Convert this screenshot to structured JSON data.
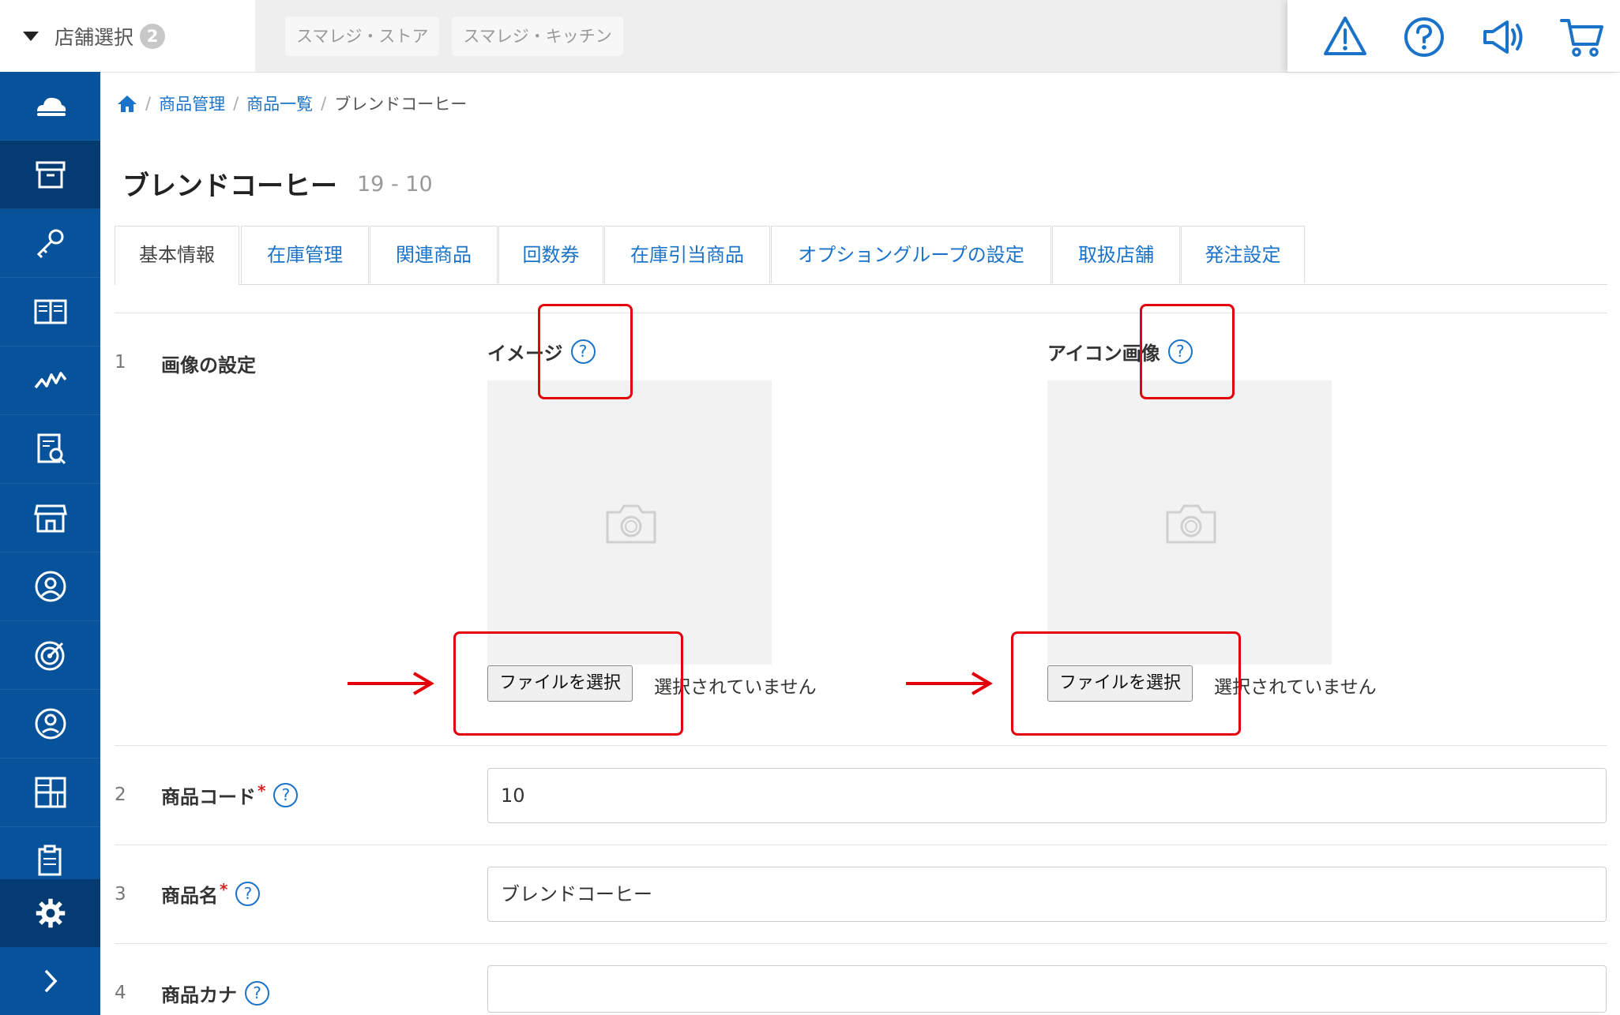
{
  "topbar": {
    "store_select_label": "店舗選択",
    "store_count": "2",
    "store_chips": [
      "スマレジ・ストア",
      "スマレジ・キッチン"
    ],
    "icons": [
      "alert-triangle-icon",
      "help-circle-icon",
      "megaphone-icon",
      "cart-icon"
    ]
  },
  "sidebar": {
    "items": [
      "cloud-icon",
      "archive-box-icon",
      "key-icon",
      "book-icon",
      "chart-line-icon",
      "report-search-icon",
      "store-icon",
      "user-circle-icon",
      "target-icon",
      "person-icon",
      "grid-icon",
      "clipboard-icon"
    ],
    "active_index": 1,
    "settings_icon": "gear-icon",
    "expand_icon": "chevron-right-icon"
  },
  "breadcrumb": {
    "home_icon": "home-icon",
    "items": [
      "商品管理",
      "商品一覧"
    ],
    "current": "ブレンドコーヒー"
  },
  "page": {
    "title": "ブレンドコーヒー",
    "subtitle": "19 - 10"
  },
  "tabs": [
    "基本情報",
    "在庫管理",
    "関連商品",
    "回数券",
    "在庫引当商品",
    "オプショングループの設定",
    "取扱店舗",
    "発注設定"
  ],
  "active_tab": 0,
  "form": {
    "row1": {
      "num": "1",
      "label": "画像の設定",
      "image": {
        "label": "イメージ",
        "button": "ファイルを選択",
        "status": "選択されていません"
      },
      "icon_image": {
        "label": "アイコン画像",
        "button": "ファイルを選択",
        "status": "選択されていません"
      }
    },
    "row2": {
      "num": "2",
      "label": "商品コード",
      "required": "*",
      "value": "10"
    },
    "row3": {
      "num": "3",
      "label": "商品名",
      "required": "*",
      "value": "ブレンドコーヒー"
    },
    "row4": {
      "num": "4",
      "label": "商品カナ",
      "value": ""
    },
    "help_char": "?"
  },
  "colors": {
    "sidebar": "#07539b",
    "sidebar_active": "#043b73",
    "link": "#1a73c9",
    "annotation": "#e3000b"
  }
}
